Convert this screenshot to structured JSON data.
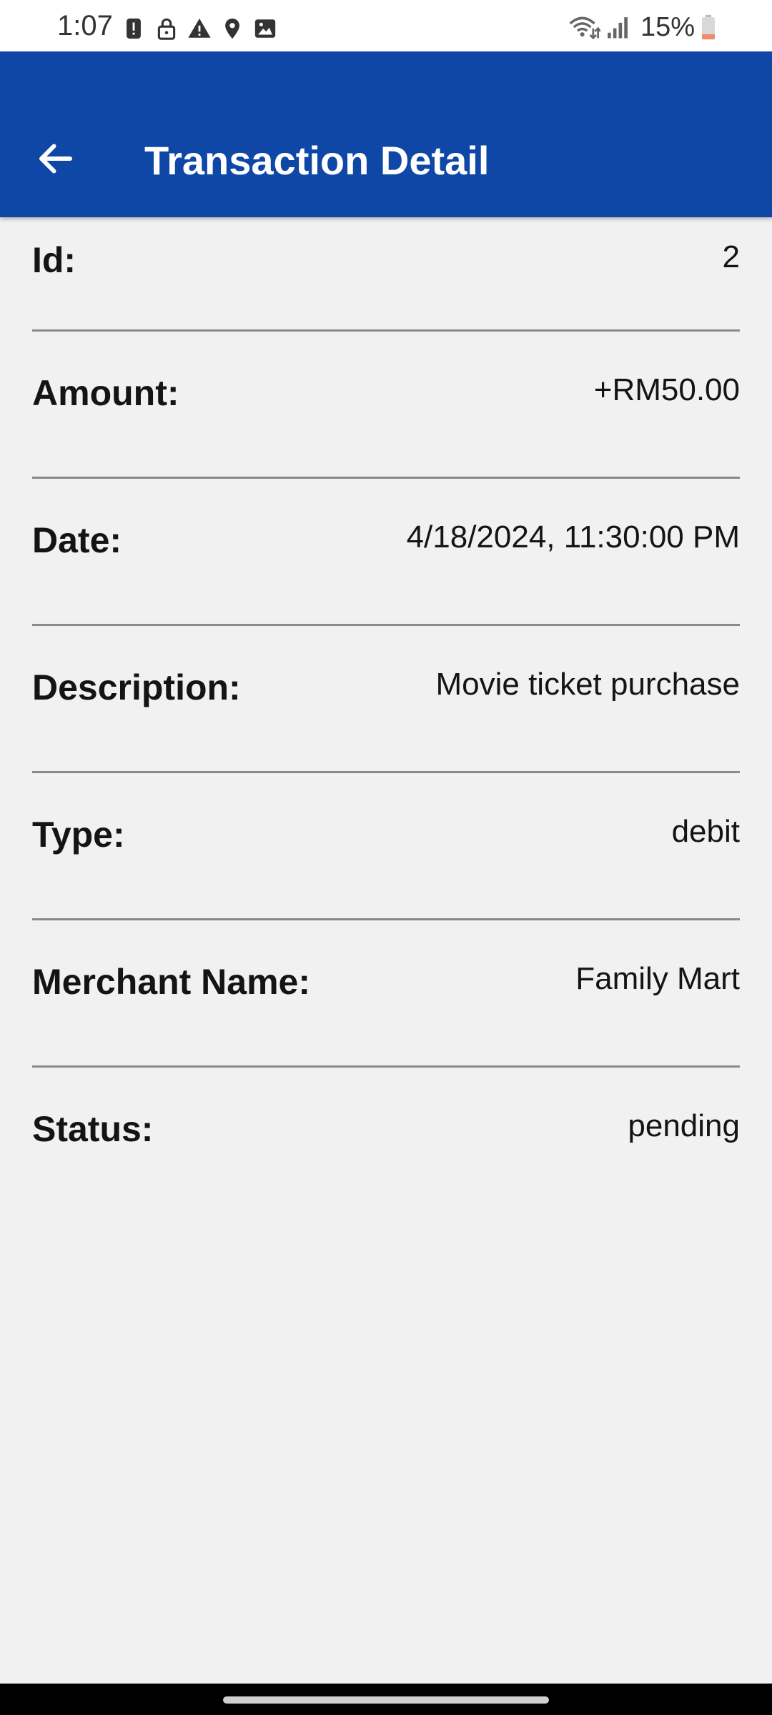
{
  "status_bar": {
    "time": "1:07",
    "left_icons": [
      "alert-icon",
      "lock-icon",
      "warning-icon",
      "location-pin-icon",
      "image-icon"
    ],
    "right_icons": [
      "wifi-icon",
      "signal-icon",
      "battery-icon"
    ],
    "battery_percent": "15%"
  },
  "app_bar": {
    "title": "Transaction Detail",
    "back_icon": "arrow-left-icon",
    "color": "#0e47a5"
  },
  "details": [
    {
      "label": "Id:",
      "value": "2"
    },
    {
      "label": "Amount:",
      "value": "+RM50.00"
    },
    {
      "label": "Date:",
      "value": "4/18/2024, 11:30:00 PM"
    },
    {
      "label": "Description:",
      "value": "Movie ticket purchase"
    },
    {
      "label": "Type:",
      "value": "debit"
    },
    {
      "label": "Merchant Name:",
      "value": "Family Mart"
    },
    {
      "label": "Status:",
      "value": "pending"
    }
  ]
}
